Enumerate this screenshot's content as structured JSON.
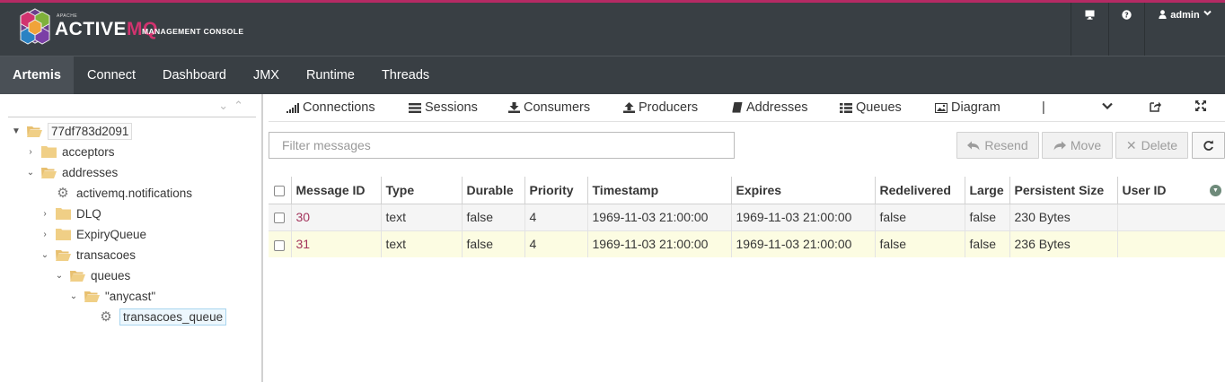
{
  "brand": {
    "apache": "APACHE",
    "name_part1": "ACTIVE",
    "name_part2": "MQ",
    "subtitle": "MANAGEMENT CONSOLE"
  },
  "utility": {
    "monitor_icon": "monitor-icon",
    "help_icon": "help-icon",
    "user_label": "admin"
  },
  "primary_nav": [
    "Artemis",
    "Connect",
    "Dashboard",
    "JMX",
    "Runtime",
    "Threads"
  ],
  "sidebar": {
    "tree": [
      {
        "label": "77df783d2091",
        "icon": "folder-open"
      },
      {
        "label": "acceptors",
        "icon": "folder"
      },
      {
        "label": "addresses",
        "icon": "folder-open"
      },
      {
        "label": "activemq.notifications",
        "icon": "gear"
      },
      {
        "label": "DLQ",
        "icon": "folder"
      },
      {
        "label": "ExpiryQueue",
        "icon": "folder"
      },
      {
        "label": "transacoes",
        "icon": "folder-open"
      },
      {
        "label": "queues",
        "icon": "folder-open"
      },
      {
        "label": "\"anycast\"",
        "icon": "folder-open"
      },
      {
        "label": "transacoes_queue",
        "icon": "gear"
      }
    ]
  },
  "subnav": [
    "Connections",
    "Sessions",
    "Consumers",
    "Producers",
    "Addresses",
    "Queues",
    "Diagram",
    "|"
  ],
  "filter": {
    "placeholder": "Filter messages"
  },
  "actions": {
    "resend": "Resend",
    "move": "Move",
    "delete": "Delete"
  },
  "table": {
    "columns": [
      "Message ID",
      "Type",
      "Durable",
      "Priority",
      "Timestamp",
      "Expires",
      "Redelivered",
      "Large",
      "Persistent Size",
      "User ID"
    ],
    "rows": [
      [
        "30",
        "text",
        "false",
        "4",
        "1969-11-03 21:00:00",
        "1969-11-03 21:00:00",
        "false",
        "false",
        "230 Bytes",
        ""
      ],
      [
        "31",
        "text",
        "false",
        "4",
        "1969-11-03 21:00:00",
        "1969-11-03 21:00:00",
        "false",
        "false",
        "236 Bytes",
        ""
      ]
    ]
  },
  "colors": {
    "masthead": "#393f44",
    "accent": "#b52a64",
    "selected_row": "#fcfce2"
  }
}
